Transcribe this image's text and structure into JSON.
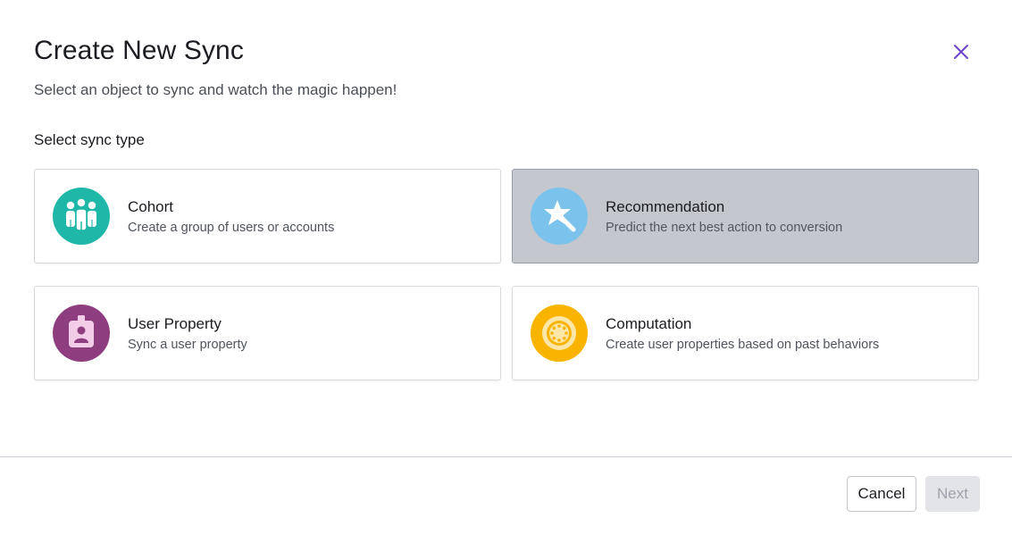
{
  "dialog": {
    "title": "Create New Sync",
    "subtitle": "Select an object to sync and watch the magic happen!",
    "section_label": "Select sync type",
    "close_icon": "close-icon"
  },
  "options": [
    {
      "title": "Cohort",
      "description": "Create a group of users or accounts",
      "icon": "cohort-icon",
      "icon_color": "#1fb7a8",
      "selected": false
    },
    {
      "title": "Recommendation",
      "description": "Predict the next best action to conversion",
      "icon": "magic-wand-icon",
      "icon_color": "#7bc3ec",
      "selected": true
    },
    {
      "title": "User Property",
      "description": "Sync a user property",
      "icon": "user-badge-icon",
      "icon_color": "#8e3d7e",
      "selected": false
    },
    {
      "title": "Computation",
      "description": "Create user properties based on past behaviors",
      "icon": "computation-icon",
      "icon_color": "#f9b400",
      "selected": false
    }
  ],
  "footer": {
    "cancel_label": "Cancel",
    "next_label": "Next",
    "next_enabled": false
  },
  "colors": {
    "accent": "#6e45c9",
    "selected_card": "#c5c7ce",
    "disabled_button": "#e2e4e8"
  }
}
